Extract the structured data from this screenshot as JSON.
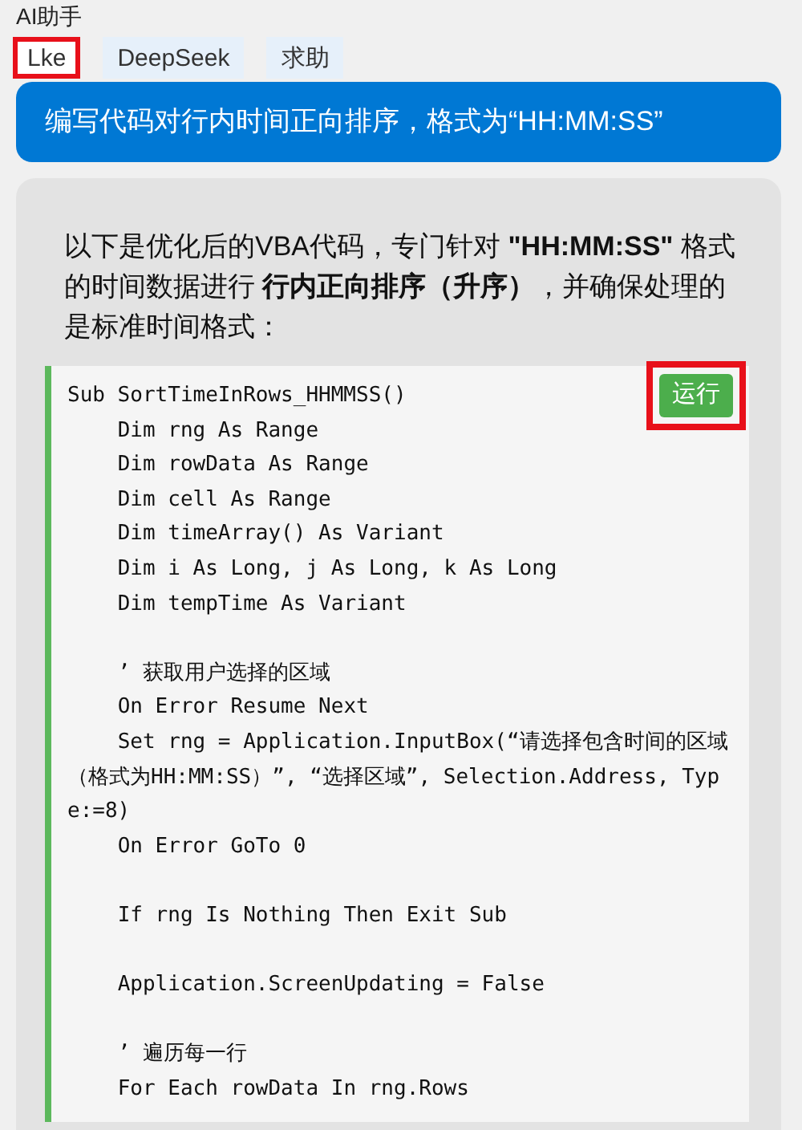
{
  "window": {
    "title": "AI助手"
  },
  "tabs": [
    {
      "label": "Lke",
      "selected": true,
      "highlighted": true
    },
    {
      "label": "DeepSeek",
      "selected": false,
      "highlighted": false
    },
    {
      "label": "求助",
      "selected": false,
      "highlighted": false
    }
  ],
  "user_message": "编写代码对行内时间正向排序，格式为“HH:MM:SS”",
  "reply": {
    "intro": "以下是优化后的VBA代码，专门针对 **\"HH:MM:SS\"** 格式的时间数据进行 **行内正向排序（升序）**，并确保处理的是标准时间格式：",
    "code_block": {
      "run_button": {
        "label": "运行",
        "highlighted": true
      },
      "lines": [
        "Sub SortTimeInRows_HHMMSS()",
        "    Dim rng As Range",
        "    Dim rowData As Range",
        "    Dim cell As Range",
        "    Dim timeArray() As Variant",
        "    Dim i As Long, j As Long, k As Long",
        "    Dim tempTime As Variant",
        {
          "text": "    ’ 获取用户选择的区域",
          "blank_before": true
        },
        "    On Error Resume Next",
        "    Set rng = Application.InputBox(“请选择包含时间的区域（格式为HH:MM:SS）”, “选择区域”, Selection.Address, Type:=8)",
        "    On Error GoTo 0",
        {
          "text": "    If rng Is Nothing Then Exit Sub",
          "blank_before": true
        },
        {
          "text": "    Application.ScreenUpdating = False",
          "blank_before": true
        },
        {
          "text": "    ’ 遍历每一行",
          "blank_before": true
        },
        "    For Each rowData In rng.Rows"
      ]
    }
  }
}
